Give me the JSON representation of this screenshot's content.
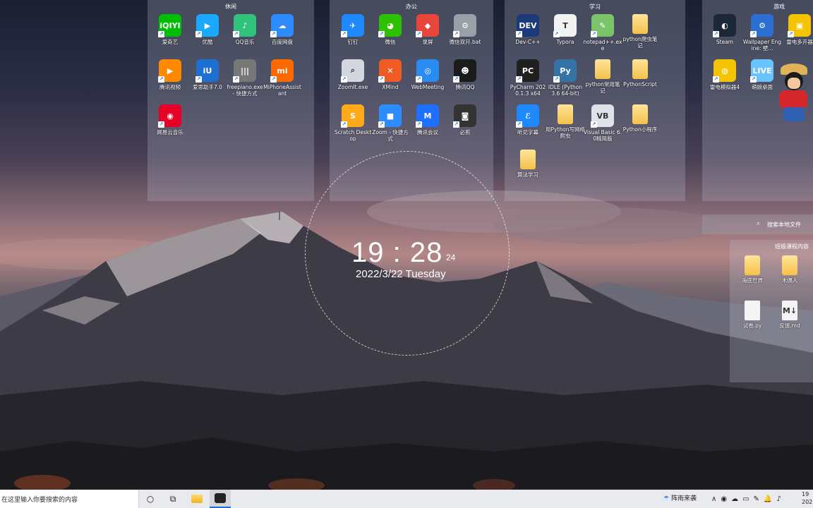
{
  "fences": [
    {
      "title": "休闲",
      "icons": [
        {
          "label": "爱奇艺",
          "text": "iQIYI",
          "color": "#00be06",
          "col": 0,
          "row": 0
        },
        {
          "label": "优酷",
          "text": "▶",
          "color": "#1aa9ff",
          "col": 1,
          "row": 0
        },
        {
          "label": "QQ音乐",
          "text": "♪",
          "color": "#31c27c",
          "col": 2,
          "row": 0
        },
        {
          "label": "百度网盘",
          "text": "☁",
          "color": "#2e8cff",
          "col": 3,
          "row": 0
        },
        {
          "label": "腾讯视频",
          "text": "▶",
          "color": "#ff8a00",
          "col": 0,
          "row": 1
        },
        {
          "label": "爱思助手7.0",
          "text": "iU",
          "color": "#1f6fd1",
          "col": 1,
          "row": 1
        },
        {
          "label": "freepiano.exe - 快捷方式",
          "text": "|||",
          "color": "#777777",
          "col": 2,
          "row": 1
        },
        {
          "label": "MiPhoneAssistant",
          "text": "mi",
          "color": "#ff6a00",
          "col": 3,
          "row": 1
        },
        {
          "label": "网易云音乐",
          "text": "◉",
          "color": "#e60026",
          "col": 0,
          "row": 2
        }
      ]
    },
    {
      "title": "办公",
      "icons": [
        {
          "label": "钉钉",
          "text": "✈",
          "color": "#1e88ff",
          "col": 0,
          "row": 0
        },
        {
          "label": "微信",
          "text": "◕",
          "color": "#2dc100",
          "col": 1,
          "row": 0
        },
        {
          "label": "录屏",
          "text": "◆",
          "color": "#e8463a",
          "col": 2,
          "row": 0
        },
        {
          "label": "微信双开.bat",
          "text": "⚙",
          "color": "#9aa0a8",
          "col": 3,
          "row": 0
        },
        {
          "label": "ZoomIt.exe",
          "text": "⌕",
          "color": "#d4d8de",
          "col": 0,
          "row": 1
        },
        {
          "label": "XMind",
          "text": "✕",
          "color": "#f05a24",
          "col": 1,
          "row": 1
        },
        {
          "label": "WebMeeting",
          "text": "◎",
          "color": "#2a8cf0",
          "col": 2,
          "row": 1
        },
        {
          "label": "腾讯QQ",
          "text": "☻",
          "color": "#1b1b1b",
          "col": 3,
          "row": 1
        },
        {
          "label": "Scratch Desktop",
          "text": "S",
          "color": "#ffab19",
          "col": 0,
          "row": 2
        },
        {
          "label": "Zoom - 快捷方式",
          "text": "■",
          "color": "#2d8cff",
          "col": 1,
          "row": 2
        },
        {
          "label": "腾讯会议",
          "text": "M",
          "color": "#1e6fff",
          "col": 2,
          "row": 2
        },
        {
          "label": "必剪",
          "text": "◙",
          "color": "#333333",
          "col": 3,
          "row": 2
        }
      ]
    },
    {
      "title": "学习",
      "icons": [
        {
          "label": "Dev-C++",
          "text": "DEV",
          "color": "#1a3a7a",
          "col": 0,
          "row": 0
        },
        {
          "label": "Typora",
          "text": "T",
          "color": "#f2f2f2",
          "col": 1,
          "row": 0
        },
        {
          "label": "notepad++.exe",
          "text": "✎",
          "color": "#7cc46a",
          "col": 2,
          "row": 0
        },
        {
          "label": "python爬虫笔记",
          "text": "",
          "color": "folder",
          "col": 3,
          "row": 0
        },
        {
          "label": "PyCharm 2020.1.3 x64",
          "text": "PC",
          "color": "#1f1f1f",
          "col": 0,
          "row": 1
        },
        {
          "label": "IDLE (Python 3.6 64-bit)",
          "text": "Py",
          "color": "#3572a5",
          "col": 1,
          "row": 1
        },
        {
          "label": "python常用笔记",
          "text": "",
          "color": "folder",
          "col": 2,
          "row": 1
        },
        {
          "label": "PythonScript",
          "text": "",
          "color": "folder",
          "col": 3,
          "row": 1
        },
        {
          "label": "听见字幕",
          "text": "ℰ",
          "color": "#1e88ff",
          "col": 0,
          "row": 2
        },
        {
          "label": "用Python写网络爬虫",
          "text": "",
          "color": "folder",
          "col": 1,
          "row": 2
        },
        {
          "label": "Visual Basic 6.0精简版",
          "text": "VB",
          "color": "#dde3e8",
          "col": 2,
          "row": 2
        },
        {
          "label": "Python小程序",
          "text": "",
          "color": "folder",
          "col": 3,
          "row": 2
        },
        {
          "label": "算法学习",
          "text": "",
          "color": "folder",
          "col": 0,
          "row": 3
        }
      ]
    },
    {
      "title": "游戏",
      "icons": [
        {
          "label": "Steam",
          "text": "◐",
          "color": "#1b2838",
          "col": 0,
          "row": 0
        },
        {
          "label": "Wallpaper Engine: 壁...",
          "text": "⚙",
          "color": "#2b6fd0",
          "col": 1,
          "row": 0
        },
        {
          "label": "雷电多开器",
          "text": "▣",
          "color": "#f5c400",
          "col": 2,
          "row": 0
        },
        {
          "label": "雷电模拟器4",
          "text": "◍",
          "color": "#f5c400",
          "col": 0,
          "row": 1
        },
        {
          "label": "萌娘桌面",
          "text": "LIVE",
          "color": "#69c3ff",
          "col": 1,
          "row": 1
        }
      ]
    },
    {
      "title": "班级课程内容",
      "icons": [
        {
          "label": "海底世界",
          "text": "",
          "color": "folder",
          "col": 0,
          "row": 0
        },
        {
          "label": "木偶人",
          "text": "",
          "color": "folder",
          "col": 1,
          "row": 0
        },
        {
          "label": "试卷.py",
          "text": "",
          "color": "file",
          "col": 0,
          "row": 1
        },
        {
          "label": "反馈.md",
          "text": "M↓",
          "color": "file",
          "col": 1,
          "row": 1
        }
      ]
    }
  ],
  "clock": {
    "time": "19 : 28",
    "seconds": "24",
    "date": "2022/3/22 Tuesday"
  },
  "file_search": {
    "placeholder": "搜索本地文件",
    "icon": "search-icon"
  },
  "taskbar": {
    "search_placeholder": "在这里输入你要搜索的内容",
    "cortana_icon": "○",
    "taskview_icon": "⧉",
    "weather": "阵雨来袭",
    "tray_icons": [
      "∧",
      "◉",
      "☁",
      "▭",
      "✎",
      "🔔",
      "♪"
    ],
    "clock_time": "19",
    "clock_date": "202"
  }
}
